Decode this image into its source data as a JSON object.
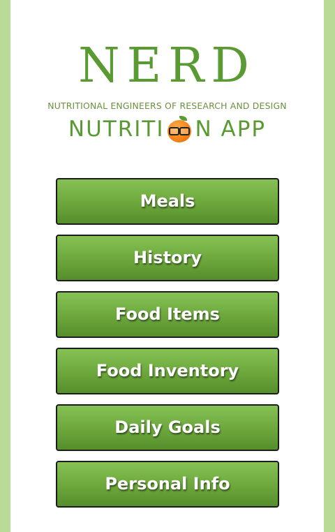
{
  "logo": {
    "title": "NERD",
    "subtitle": "NUTRITIONAL ENGINEERS OF RESEARCH AND DESIGN",
    "app_prefix": "NUTRITI",
    "app_suffix": "N APP"
  },
  "menu": {
    "items": [
      {
        "label": "Meals"
      },
      {
        "label": "History"
      },
      {
        "label": "Food Items"
      },
      {
        "label": "Food Inventory"
      },
      {
        "label": "Daily Goals"
      },
      {
        "label": "Personal Info"
      }
    ]
  },
  "colors": {
    "background": "#b9db97",
    "panel": "#ffffff",
    "brand_green": "#5a9a32",
    "button_top": "#86c154",
    "button_bottom": "#568e2b"
  }
}
